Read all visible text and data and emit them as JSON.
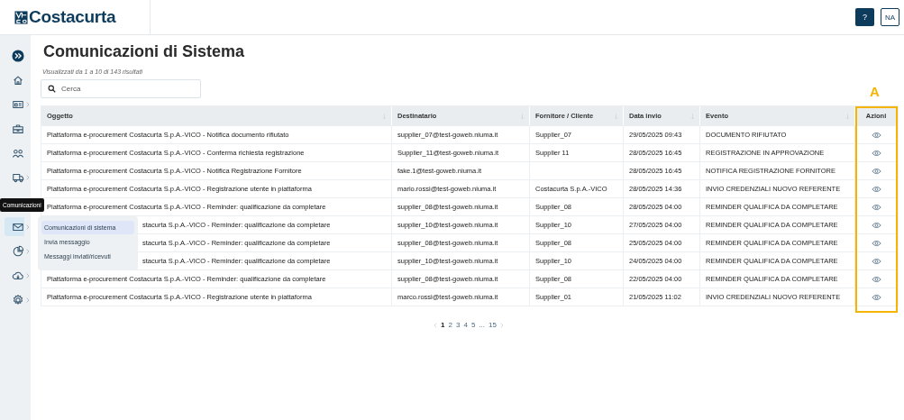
{
  "header": {
    "logo": "Costacurta",
    "help_button": "?",
    "user_button": "NA"
  },
  "sidebar": {
    "items": [
      {
        "kind": "expand",
        "submenu": false,
        "selected": false
      },
      {
        "kind": "home",
        "submenu": false,
        "selected": false
      },
      {
        "kind": "idcard",
        "submenu": true,
        "selected": false
      },
      {
        "kind": "briefcase",
        "submenu": false,
        "selected": false
      },
      {
        "kind": "people",
        "submenu": false,
        "selected": false
      },
      {
        "kind": "truck",
        "submenu": true,
        "selected": false
      },
      {
        "kind": "mail",
        "submenu": true,
        "selected": true
      },
      {
        "kind": "chart",
        "submenu": true,
        "selected": false
      },
      {
        "kind": "cloud",
        "submenu": true,
        "selected": false
      },
      {
        "kind": "gear",
        "submenu": true,
        "selected": false
      }
    ],
    "tooltip": "Comunicazioni",
    "submenu": [
      {
        "label": "Comunicazioni di sistema",
        "selected": true
      },
      {
        "label": "Invia messaggio",
        "selected": false
      },
      {
        "label": "Messaggi inviati/ricevuti",
        "selected": false
      }
    ]
  },
  "page": {
    "title": "Comunicazioni di Sistema",
    "results": "Visualizzati da 1 a 10 di 143 risultati",
    "search": {
      "placeholder": "Cerca"
    }
  },
  "annotation": {
    "label": "A"
  },
  "table": {
    "columns": [
      {
        "label": "Oggetto",
        "sortable": true
      },
      {
        "label": "Destinatario",
        "sortable": true
      },
      {
        "label": "Fornitore / Cliente",
        "sortable": true
      },
      {
        "label": "Data invio",
        "sortable": true
      },
      {
        "label": "Evento",
        "sortable": true
      },
      {
        "label": "Azioni",
        "sortable": false
      }
    ],
    "rows": [
      {
        "oggetto": "Piattaforma e-procurement Costacurta S.p.A.-VICO - Notifica documento rifiutato",
        "destinatario": "supplier_07@test-goweb.niuma.it",
        "fornitore": "Supplier_07",
        "data": "29/05/2025 09:43",
        "evento": "DOCUMENTO RIFIUTATO"
      },
      {
        "oggetto": "Piattaforma e-procurement Costacurta S.p.A.-VICO - Conferma richiesta registrazione",
        "destinatario": "Supplier_11@test-goweb.niuma.it",
        "fornitore": "Supplier 11",
        "data": "28/05/2025 16:45",
        "evento": "REGISTRAZIONE IN APPROVAZIONE"
      },
      {
        "oggetto": "Piattaforma e-procurement Costacurta S.p.A.-VICO - Notifica Registrazione Fornitore",
        "destinatario": "fake.1@test-goweb.niuma.it",
        "fornitore": "",
        "data": "28/05/2025 16:45",
        "evento": "NOTIFICA REGISTRAZIONE FORNITORE"
      },
      {
        "oggetto": "Piattaforma e-procurement Costacurta S.p.A.-VICO - Registrazione utente in piattaforma",
        "destinatario": "mario.rossi@test-goweb.niuma.it",
        "fornitore": "Costacurta S.p.A.-VICO",
        "data": "28/05/2025 14:36",
        "evento": "INVIO CREDENZIALI NUOVO REFERENTE"
      },
      {
        "oggetto": "Piattaforma e-procurement Costacurta S.p.A.-VICO - Reminder: qualificazione da completare",
        "destinatario": "supplier_08@test-goweb.niuma.it",
        "fornitore": "Supplier_08",
        "data": "28/05/2025 04:00",
        "evento": "REMINDER QUALIFICA DA COMPLETARE"
      },
      {
        "oggetto": "stacurta S.p.A.-VICO - Reminder: qualificazione da completare",
        "destinatario": "supplier_10@test-goweb.niuma.it",
        "fornitore": "Supplier_10",
        "data": "27/05/2025 04:00",
        "evento": "REMINDER QUALIFICA DA COMPLETARE"
      },
      {
        "oggetto": "stacurta S.p.A.-VICO - Reminder: qualificazione da completare",
        "destinatario": "supplier_08@test-goweb.niuma.it",
        "fornitore": "Supplier_08",
        "data": "25/05/2025 04:00",
        "evento": "REMINDER QUALIFICA DA COMPLETARE"
      },
      {
        "oggetto": "stacurta S.p.A.-VICO - Reminder: qualificazione da completare",
        "destinatario": "supplier_10@test-goweb.niuma.it",
        "fornitore": "Supplier_10",
        "data": "24/05/2025 04:00",
        "evento": "REMINDER QUALIFICA DA COMPLETARE"
      },
      {
        "oggetto": "Piattaforma e-procurement Costacurta S.p.A.-VICO - Reminder: qualificazione da completare",
        "destinatario": "supplier_08@test-goweb.niuma.it",
        "fornitore": "Supplier_08",
        "data": "22/05/2025 04:00",
        "evento": "REMINDER QUALIFICA DA COMPLETARE"
      },
      {
        "oggetto": "Piattaforma e-procurement Costacurta S.p.A.-VICO - Registrazione utente in piattaforma",
        "destinatario": "marco.rossi@test-goweb.niuma.it",
        "fornitore": "Supplier_01",
        "data": "21/05/2025 11:02",
        "evento": "INVIO CREDENZIALI NUOVO REFERENTE"
      }
    ]
  },
  "pagination": {
    "pages": [
      {
        "label": "1",
        "selected": true
      },
      {
        "label": "2",
        "selected": false
      },
      {
        "label": "3",
        "selected": false
      },
      {
        "label": "4",
        "selected": false
      },
      {
        "label": "5",
        "selected": false
      },
      {
        "label": "...",
        "selected": false
      },
      {
        "label": "15",
        "selected": false
      }
    ]
  }
}
